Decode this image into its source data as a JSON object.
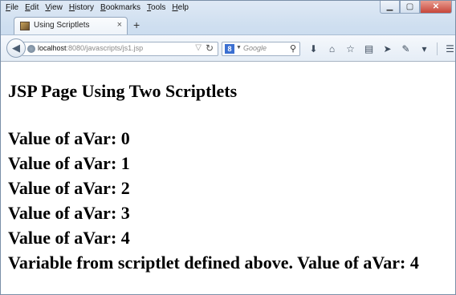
{
  "menu": [
    "File",
    "Edit",
    "View",
    "History",
    "Bookmarks",
    "Tools",
    "Help"
  ],
  "window_controls": {
    "minimize": "▁",
    "restore": "▢",
    "close": "✕"
  },
  "tab": {
    "title": "Using Scriptlets",
    "close": "×",
    "new_tab": "+"
  },
  "address": {
    "host": "localhost",
    "rest": ":8080/javascripts/js1.jsp"
  },
  "search": {
    "engine_icon": "8",
    "placeholder": "Google"
  },
  "toolbar_icons": [
    "download-icon",
    "home-icon",
    "bookmark-star-icon",
    "reading-list-icon",
    "send-icon",
    "extension-icon",
    "dropdown-icon",
    "menu-icon"
  ],
  "page": {
    "heading": "JSP Page Using Two Scriptlets",
    "lines": [
      "Value of aVar: 0",
      "Value of aVar: 1",
      "Value of aVar: 2",
      "Value of aVar: 3",
      "Value of aVar: 4",
      "Variable from scriptlet defined above. Value of aVar: 4"
    ]
  }
}
